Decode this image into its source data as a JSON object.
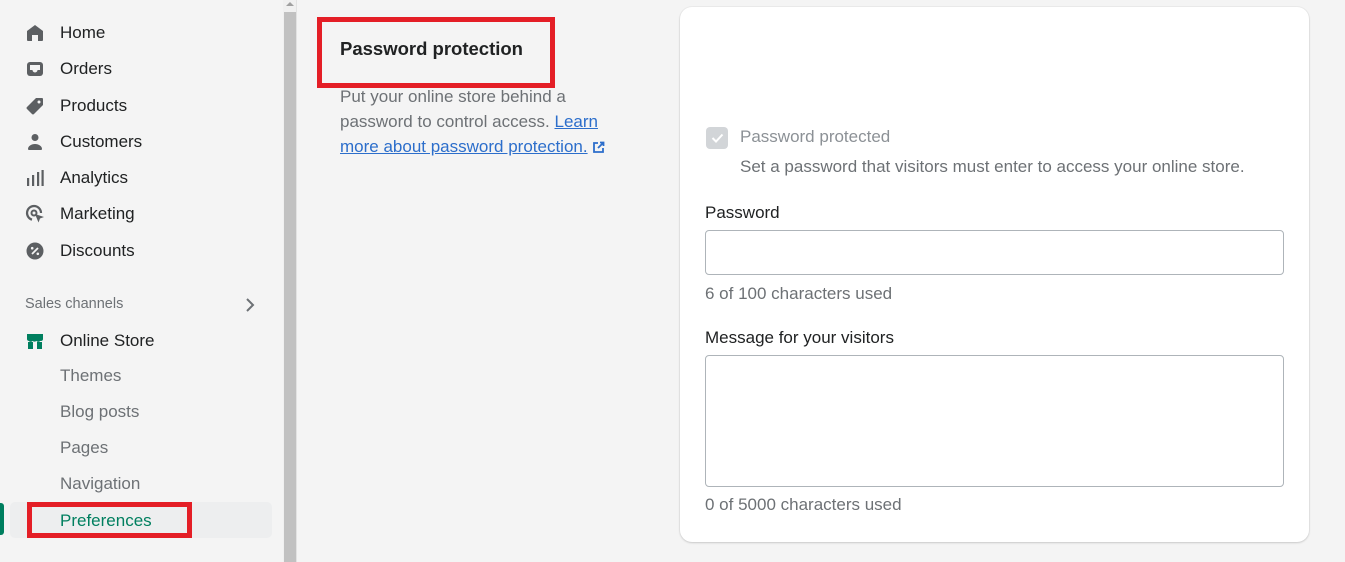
{
  "sidebar": {
    "items": [
      {
        "label": "Home",
        "icon": "home-icon"
      },
      {
        "label": "Orders",
        "icon": "inbox-icon"
      },
      {
        "label": "Products",
        "icon": "tag-icon"
      },
      {
        "label": "Customers",
        "icon": "person-icon"
      },
      {
        "label": "Analytics",
        "icon": "bar-chart-icon"
      },
      {
        "label": "Marketing",
        "icon": "target-cursor-icon"
      },
      {
        "label": "Discounts",
        "icon": "discount-badge-icon"
      }
    ],
    "sales_channels_label": "Sales channels",
    "online_store": {
      "label": "Online Store",
      "icon": "storefront-icon"
    },
    "sub_items": [
      {
        "label": "Themes"
      },
      {
        "label": "Blog posts"
      },
      {
        "label": "Pages"
      },
      {
        "label": "Navigation"
      },
      {
        "label": "Preferences",
        "active": true
      }
    ]
  },
  "section": {
    "title": "Password protection",
    "description": "Put your online store behind a password to control access.",
    "link_text": "Learn more about password protection."
  },
  "card": {
    "checkbox": {
      "label": "Password protected",
      "checked": true,
      "disabled": true
    },
    "checkbox_help": "Set a password that visitors must enter to access your online store.",
    "password": {
      "label": "Password",
      "value": "",
      "counter": "6 of 100 characters used"
    },
    "message": {
      "label": "Message for your visitors",
      "value": "",
      "counter": "0 of 5000 characters used"
    }
  },
  "colors": {
    "accent_green": "#007f5f",
    "link_blue": "#2c6ecb",
    "highlight_red": "#e41e26"
  }
}
